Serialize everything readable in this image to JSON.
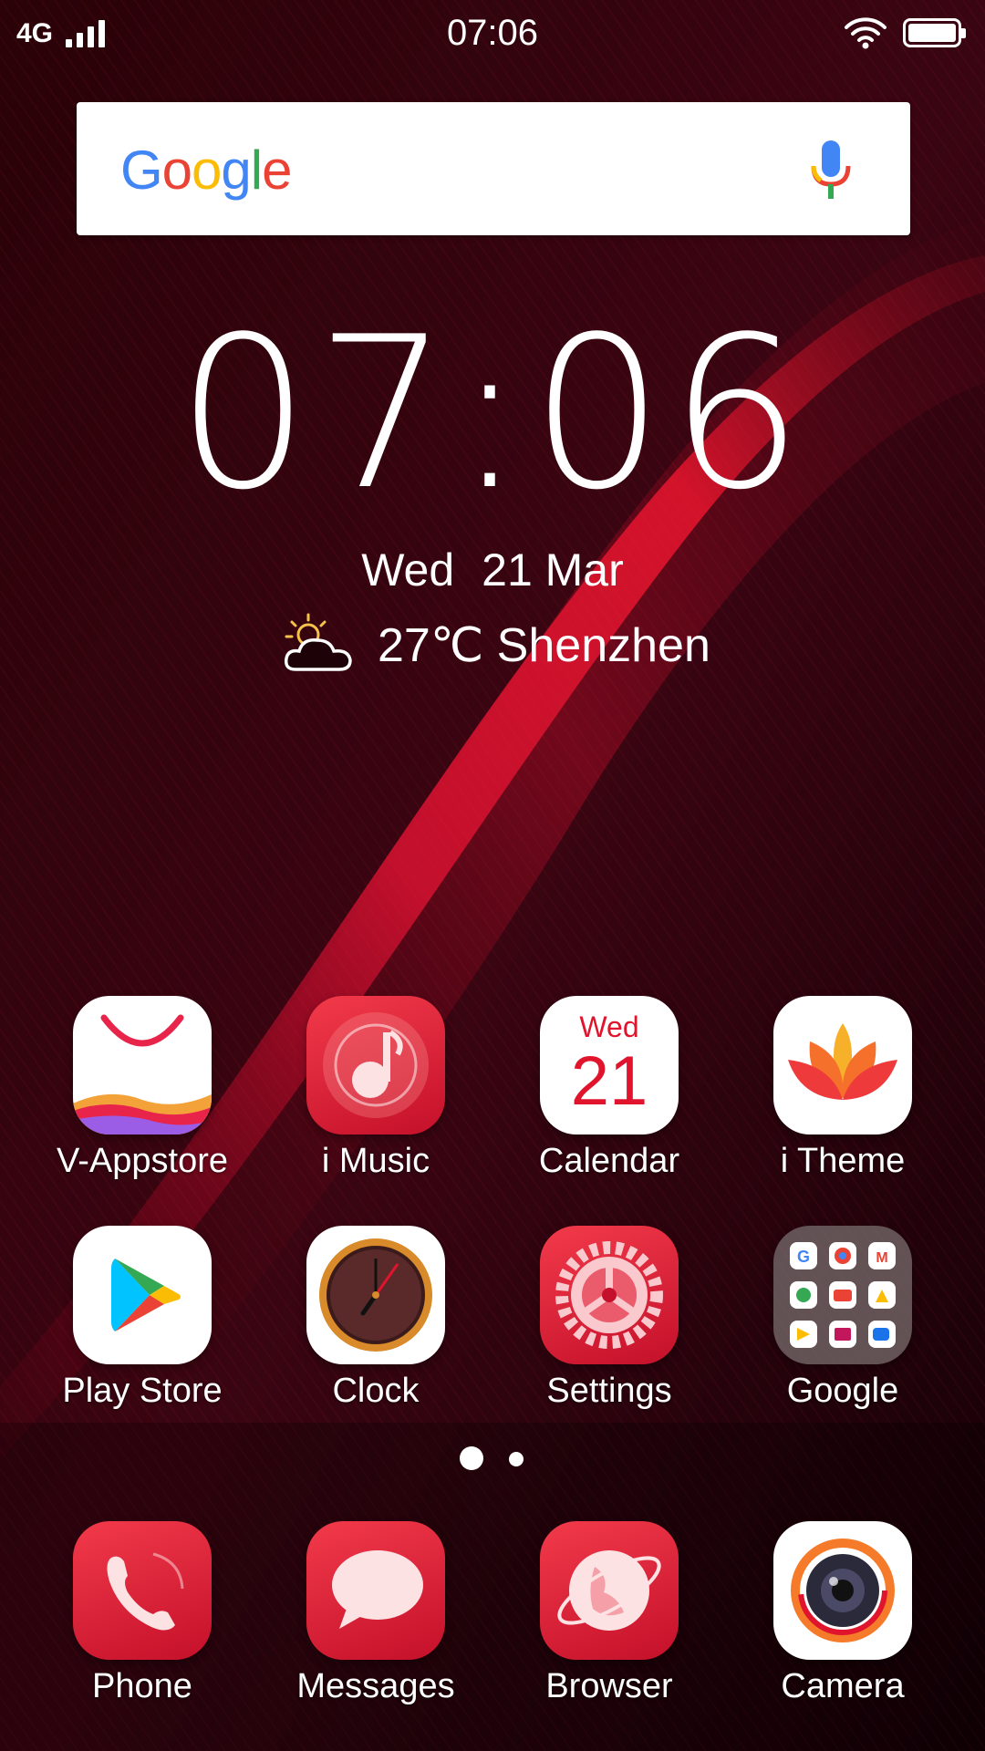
{
  "status_bar": {
    "network": "4G",
    "time": "07:06"
  },
  "search": {
    "logo_letters": [
      "G",
      "o",
      "o",
      "g",
      "l",
      "e"
    ]
  },
  "clock_widget": {
    "time": "07:06",
    "day": "Wed",
    "date": "21 Mar",
    "weather": "27℃ Shenzhen"
  },
  "apps": [
    {
      "label": "V-Appstore"
    },
    {
      "label": "i Music"
    },
    {
      "label": "Calendar",
      "icon_day": "Wed",
      "icon_date": "21"
    },
    {
      "label": "i Theme"
    },
    {
      "label": "Play Store"
    },
    {
      "label": "Clock"
    },
    {
      "label": "Settings"
    },
    {
      "label": "Google"
    }
  ],
  "dock": [
    {
      "label": "Phone"
    },
    {
      "label": "Messages"
    },
    {
      "label": "Browser"
    },
    {
      "label": "Camera"
    }
  ],
  "page_indicator": {
    "pages": 2,
    "current": 1
  },
  "colors": {
    "accent_red": "#e0142c",
    "wallpaper_dark": "#1a0208"
  }
}
